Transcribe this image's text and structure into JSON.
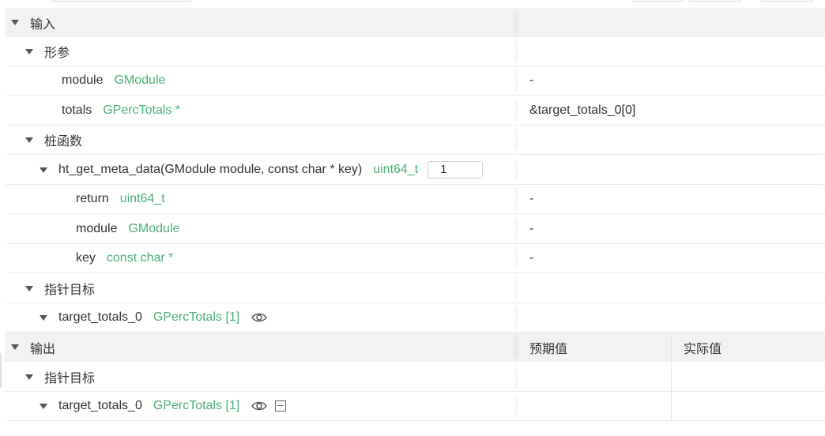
{
  "input_section": {
    "label": "输入",
    "params": {
      "label": "形参",
      "items": [
        {
          "name": "module",
          "type": "GModule",
          "value": "-"
        },
        {
          "name": "totals",
          "type": "GPercTotals *",
          "value": "&target_totals_0[0]"
        }
      ]
    },
    "stubs": {
      "label": "桩函数",
      "fn": {
        "signature": "ht_get_meta_data(GModule module, const char * key)",
        "return_type": "uint64_t",
        "count": "1",
        "items": [
          {
            "name": "return",
            "type": "uint64_t",
            "value": "-"
          },
          {
            "name": "module",
            "type": "GModule",
            "value": "-"
          },
          {
            "name": "key",
            "type": "const char *",
            "value": "-"
          }
        ]
      }
    },
    "pointer_targets": {
      "label": "指针目标",
      "item": {
        "name": "target_totals_0",
        "type": "GPercTotals [1]"
      }
    }
  },
  "output_section": {
    "label": "输出",
    "col_expected": "预期值",
    "col_actual": "实际值",
    "pointer_targets": {
      "label": "指针目标",
      "item": {
        "name": "target_totals_0",
        "type": "GPercTotals [1]"
      }
    }
  }
}
